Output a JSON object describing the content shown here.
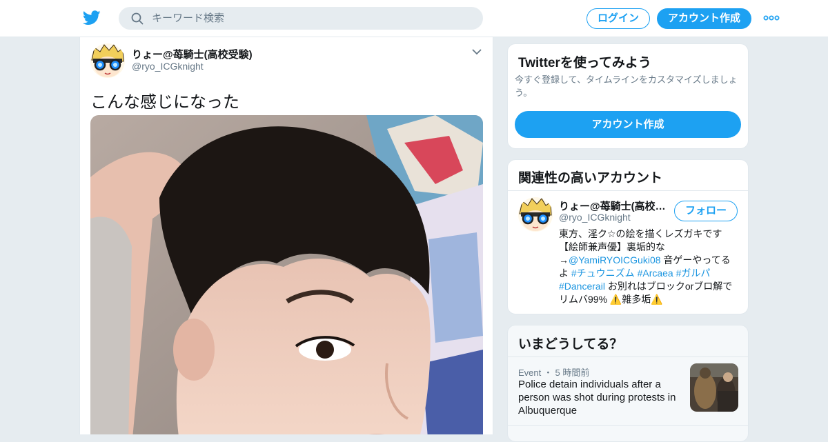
{
  "header": {
    "search_placeholder": "キーワード検索",
    "login_label": "ログイン",
    "signup_label": "アカウント作成"
  },
  "tweet": {
    "name": "りょー@苺騎士(高校受験)",
    "handle": "@ryo_ICGknight",
    "text": "こんな感じになった"
  },
  "sidebar": {
    "try_twitter": {
      "title": "Twitterを使ってみよう",
      "description": "今すぐ登録して、タイムラインをカスタマイズしましょう。",
      "button_label": "アカウント作成"
    },
    "related": {
      "title": "関連性の高いアカウント",
      "name": "りょー@苺騎士(高校受験)",
      "handle": "@ryo_ICGknight",
      "follow_label": "フォロー",
      "bio": {
        "line1": "東方、淫ク☆の絵を描くレズガキです【絵師兼声優】裏垢的な→",
        "mention": "@YamiRYOICGuki08",
        "line2": " 音ゲーやってるよ ",
        "tag1": "#チュウニズム",
        "tag2": "#Arcaea",
        "tag3": "#ガルパ",
        "tag4": "#Dancerail",
        "line3": " お別れはブロックorブロ解で リムバ99% ⚠️雑多垢⚠️"
      }
    },
    "trends": {
      "title": "いまどうしてる？",
      "category": "Event",
      "time": "5 時間前",
      "headline": "Police detain individuals after a person was shot during protests in Albuquerque"
    }
  },
  "colors": {
    "accent": "#1da1f2",
    "background": "#e6ecf0",
    "secondary_text": "#657786"
  }
}
